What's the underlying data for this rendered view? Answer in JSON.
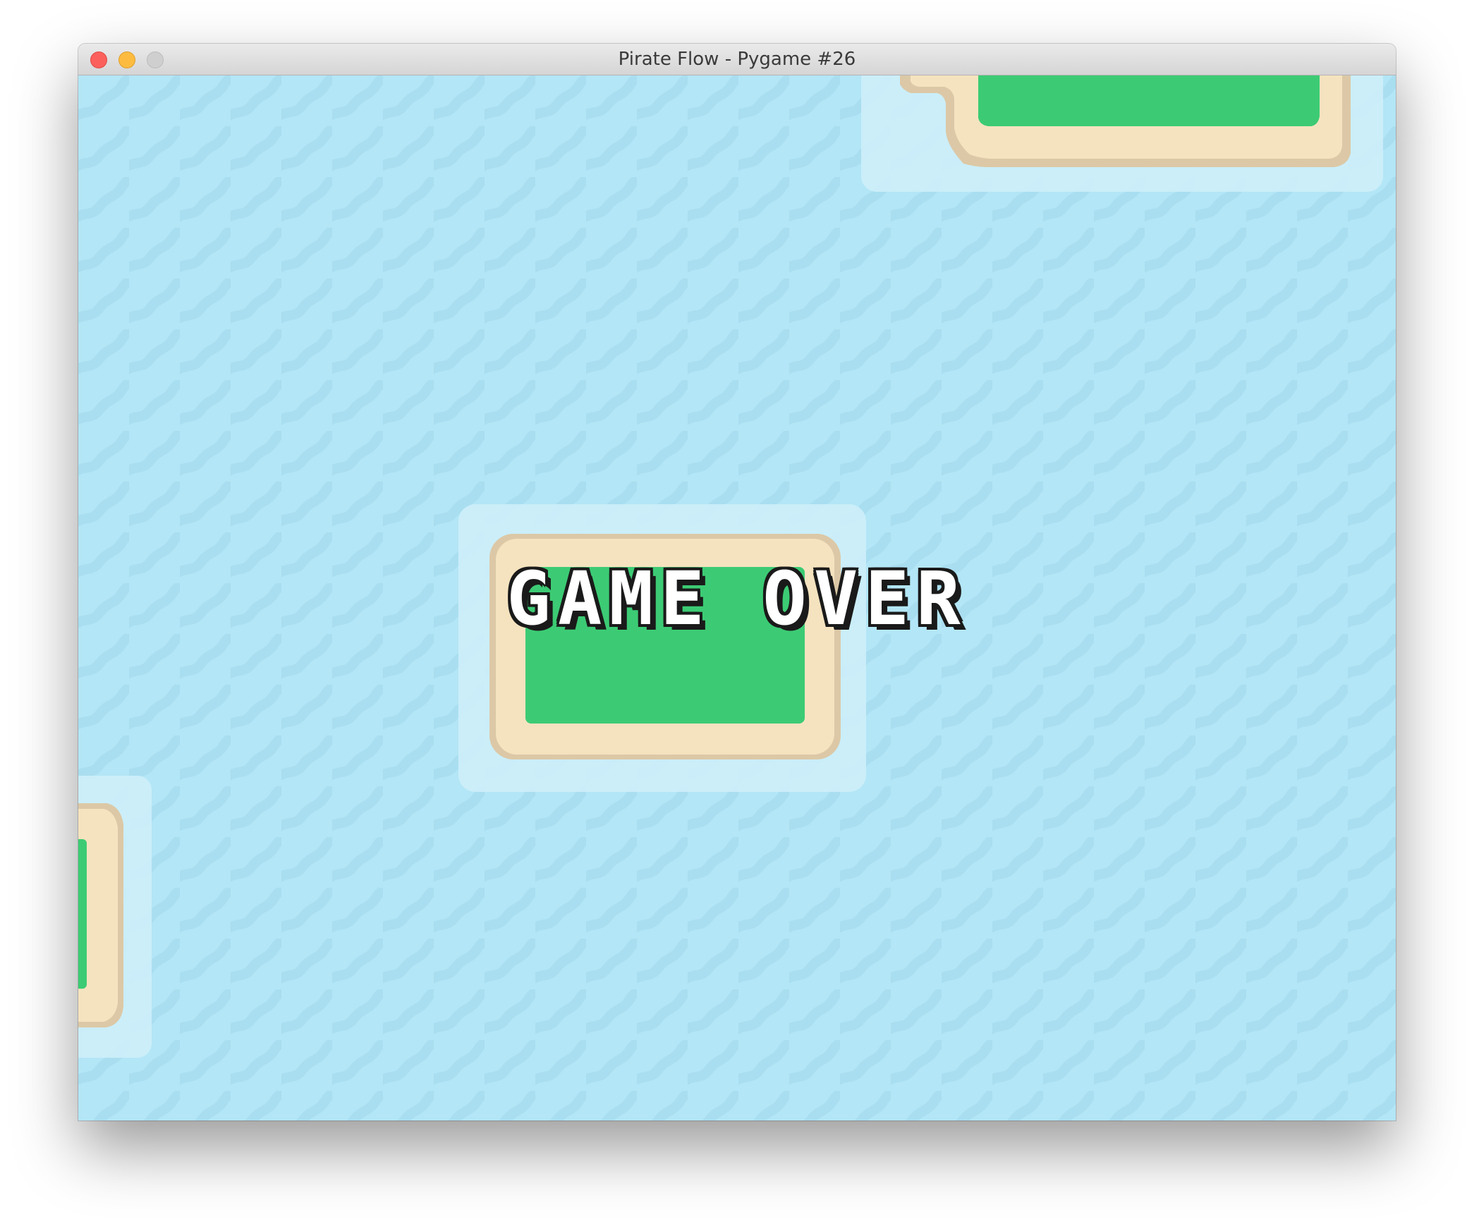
{
  "window": {
    "title": "Pirate Flow - Pygame #26"
  },
  "game": {
    "message": "GAME OVER",
    "colors": {
      "water": "#b3e6f6",
      "wave": "#a7dcef",
      "shallow": "#cdeef9",
      "sand_dark": "#dcc8a6",
      "sand": "#f5e3bf",
      "grass": "#3ccb74",
      "ship": "#8a5a2a"
    }
  }
}
